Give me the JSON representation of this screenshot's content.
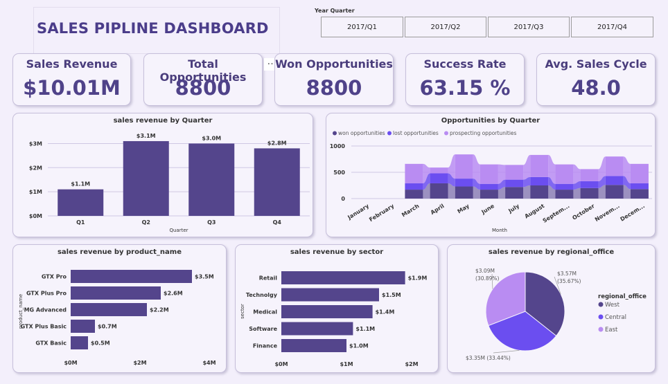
{
  "dashboard_title": "SALES PIPLINE DASHBOARD",
  "slicer": {
    "label": "Year Quarter",
    "options": [
      "2017/Q1",
      "2017/Q2",
      "2017/Q3",
      "2017/Q4"
    ]
  },
  "more_icon": "…",
  "kpis": [
    {
      "label": "Sales Revenue",
      "value": "$10.01M"
    },
    {
      "label": "Total Opportunities",
      "value": "8800"
    },
    {
      "label": "Won Opportunities",
      "value": "8800"
    },
    {
      "label": "Success Rate",
      "value": "63.15 %"
    },
    {
      "label": "Avg. Sales Cycle",
      "value": "48.0"
    }
  ],
  "colors": {
    "bar": "#54458c",
    "won": "#54458c",
    "lost": "#6b4ef0",
    "prospecting": "#b98cf2",
    "ribbon": "#8c7fb5",
    "west": "#54458c",
    "central": "#6b4ef0",
    "east": "#b98cf2"
  },
  "chart_data": [
    {
      "type": "bar",
      "title": "sales revenue by Quarter",
      "categories": [
        "Q1",
        "Q2",
        "Q3",
        "Q4"
      ],
      "values": [
        1.1,
        3.1,
        3.0,
        2.8
      ],
      "data_labels": [
        "$1.1M",
        "$3.1M",
        "$3.0M",
        "$2.8M"
      ],
      "xlabel": "Quarter",
      "ylabel": "",
      "ylim": [
        0,
        3.3
      ],
      "yticks": [
        0,
        1,
        2,
        3
      ],
      "ytick_labels": [
        "$0M",
        "$1M",
        "$2M",
        "$3M"
      ],
      "grid": true
    },
    {
      "type": "area",
      "title": "Opportunities by Quarter",
      "subtype": "ribbon",
      "categories": [
        "January",
        "February",
        "March",
        "April",
        "May",
        "June",
        "July",
        "August",
        "Septem...",
        "October",
        "Novem...",
        "Decem..."
      ],
      "series": [
        {
          "name": "won opportunities",
          "values": [
            0,
            0,
            170,
            290,
            230,
            170,
            220,
            250,
            170,
            200,
            260,
            180
          ]
        },
        {
          "name": "lost opportunities",
          "values": [
            0,
            0,
            120,
            190,
            150,
            110,
            140,
            160,
            110,
            130,
            170,
            110
          ]
        },
        {
          "name": "prospecting opportunities",
          "values": [
            0,
            0,
            370,
            110,
            460,
            370,
            280,
            420,
            370,
            230,
            370,
            370
          ]
        }
      ],
      "totals": [
        0,
        0,
        660,
        590,
        840,
        650,
        640,
        830,
        650,
        560,
        800,
        660
      ],
      "xlabel": "Month",
      "ylabel": "",
      "ylim": [
        0,
        1000
      ],
      "yticks": [
        0,
        500,
        1000
      ],
      "legend": "top-left",
      "grid": true
    },
    {
      "type": "bar",
      "orientation": "horizontal",
      "title": "sales revenue by product_name",
      "categories": [
        "GTX Pro",
        "GTX Plus Pro",
        "MG Advanced",
        "GTX Plus Basic",
        "GTX Basic"
      ],
      "values": [
        3.5,
        2.6,
        2.2,
        0.7,
        0.5
      ],
      "data_labels": [
        "$3.5M",
        "$2.6M",
        "$2.2M",
        "$0.7M",
        "$0.5M"
      ],
      "xlabel": "",
      "ylabel": "product_name",
      "xlim": [
        0,
        4
      ],
      "xticks": [
        0,
        2,
        4
      ],
      "xtick_labels": [
        "$0M",
        "$2M",
        "$4M"
      ]
    },
    {
      "type": "bar",
      "orientation": "horizontal",
      "title": "sales revenue by sector",
      "categories": [
        "Retail",
        "Technolgy",
        "Medical",
        "Software",
        "Finance"
      ],
      "values": [
        1.9,
        1.5,
        1.4,
        1.1,
        1.0
      ],
      "data_labels": [
        "$1.9M",
        "$1.5M",
        "$1.4M",
        "$1.1M",
        "$1.0M"
      ],
      "xlabel": "",
      "ylabel": "sector",
      "xlim": [
        0,
        2
      ],
      "xticks": [
        0,
        1,
        2
      ],
      "xtick_labels": [
        "$0M",
        "$1M",
        "$2M"
      ]
    },
    {
      "type": "pie",
      "title": "sales revenue by regional_office",
      "legend_title": "regional_office",
      "labels": [
        "West",
        "Central",
        "East"
      ],
      "values": [
        3.57,
        3.35,
        3.09
      ],
      "percents": [
        35.67,
        33.44,
        30.89
      ],
      "slice_labels": [
        {
          "value": "$3.57M",
          "pct": "(35.67%)"
        },
        {
          "value": "$3.35M (33.44%)",
          "pct": ""
        },
        {
          "value": "$3.09M",
          "pct": "(30.89%)"
        }
      ],
      "legend": "right"
    }
  ]
}
